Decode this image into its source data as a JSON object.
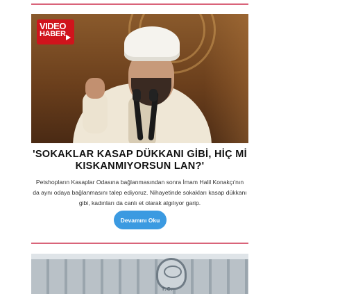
{
  "top_divider": {
    "color": "#d9647a"
  },
  "article": {
    "badge": {
      "line1": "VIDEO",
      "line2": "HABER",
      "color": "#d0141c"
    },
    "headline": "'SOKAKLAR KASAP DÜKKANI GİBİ, HİÇ Mİ KISKANMIYORSUN LAN?'",
    "summary": "Petshopların Kasaplar Odasına bağlanmasından sonra İmam Halil Konakçı'nın da aynı odaya bağlanmasını talep ediyoruz. Nihayetinde sokakları kasap dükkanı gibi, kadınları da canlı et olarak algılıyor garip.",
    "read_more_label": "Devamını Oku",
    "read_more_color": "#3b9ae1"
  },
  "next_article": {
    "image_text": "T.C."
  }
}
